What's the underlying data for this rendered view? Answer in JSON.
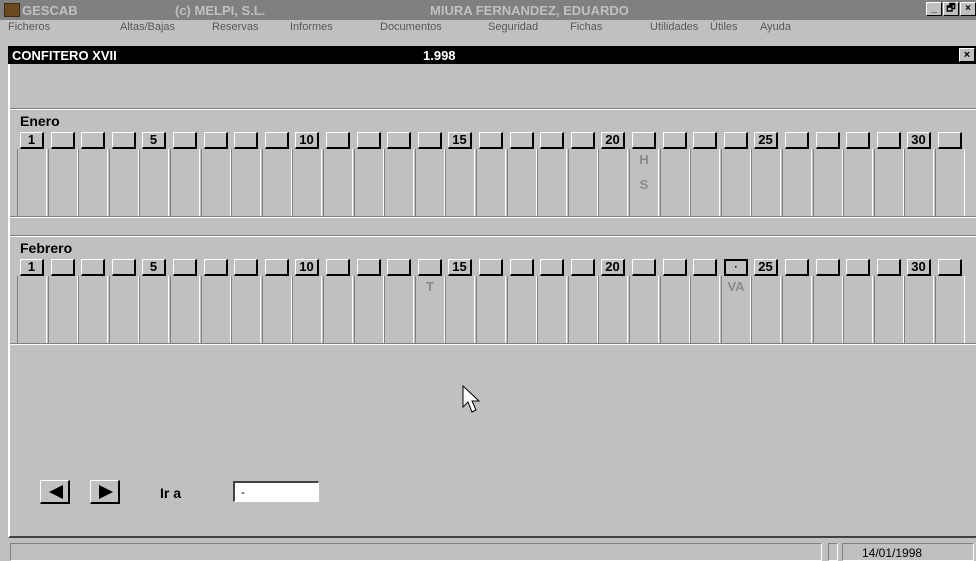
{
  "app": {
    "name": "GESCAB",
    "copyright": "(c) MELPI, S.L.",
    "user": "MIURA FERNANDEZ, EDUARDO",
    "controls": [
      "_",
      "🗗",
      "×"
    ]
  },
  "menu": [
    "Ficheros",
    "Altas/Bajas",
    "Reservas",
    "Informes",
    "Documentos",
    "Seguridad",
    "Fichas",
    "Utilidades",
    "Útiles",
    "Ayuda"
  ],
  "child": {
    "title": "CONFITERO XVII",
    "year": "1.998",
    "close": "×"
  },
  "months": [
    {
      "name": "Enero",
      "days": [
        "1",
        "",
        "",
        "",
        "5",
        "",
        "",
        "",
        "",
        "10",
        "",
        "",
        "",
        "",
        "15",
        "",
        "",
        "",
        "",
        "20",
        "",
        "",
        "",
        "",
        "25",
        "",
        "",
        "",
        "",
        "30",
        ""
      ],
      "marks": [
        {
          "day": 21,
          "row": 1,
          "text": "H"
        },
        {
          "day": 21,
          "row": 2,
          "text": "S"
        }
      ]
    },
    {
      "name": "Febrero",
      "days": [
        "1",
        "",
        "",
        "",
        "5",
        "",
        "",
        "",
        "",
        "10",
        "",
        "",
        "",
        "",
        "15",
        "",
        "",
        "",
        "",
        "20",
        "",
        "",
        "",
        "·",
        "25",
        "",
        "",
        "",
        "",
        "30",
        ""
      ],
      "marks": [
        {
          "day": 14,
          "row": 1,
          "text": "T"
        },
        {
          "day": 24,
          "row": 1,
          "text": "VA"
        }
      ]
    }
  ],
  "nav": {
    "prev_icon": "arrow-left-icon",
    "next_icon": "arrow-right-icon",
    "goto_label": "Ir a",
    "goto_value": "-"
  },
  "status": {
    "date": "14/01/1998"
  }
}
